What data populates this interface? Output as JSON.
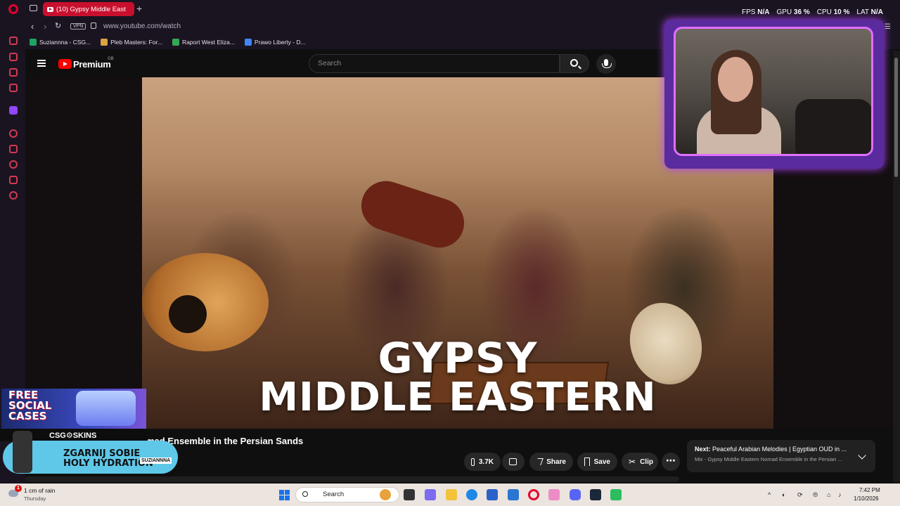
{
  "browser": {
    "tab_title": "(10) Gypsy Middle East",
    "new_tab": "+",
    "vpn_label": "VPN",
    "url": "www.youtube.com/watch",
    "bookmarks": [
      {
        "label": "Suziannna - CSG...",
        "color": "#1fa463"
      },
      {
        "label": "Pleb Masters: For...",
        "color": "#d9a441"
      },
      {
        "label": "Raport West Eliza...",
        "color": "#34a853"
      },
      {
        "label": "Prawo Liberty - D...",
        "color": "#4285f4"
      }
    ]
  },
  "youtube": {
    "brand": "Premium",
    "region": "GB",
    "search_placeholder": "Search",
    "thumbnail_line1": "GYPSY",
    "thumbnail_line2": "MIDDLE EASTERN",
    "title_visible": "mad Ensemble in the Persian Sands",
    "like_count": "3.7K",
    "share_label": "Share",
    "save_label": "Save",
    "clip_label": "Clip",
    "more_label": "⋯",
    "next_prefix": "Next:",
    "next_title": "Peaceful Arabian Melodies | Egyptian OUD in ...",
    "next_sub": "Mix - Gypsy Middle Eastern Nomad Ensemble in the Persian ..."
  },
  "stats": {
    "fps_label": "FPS",
    "fps_value": "N/A",
    "gpu_label": "GPU",
    "gpu_value": "36 %",
    "cpu_label": "CPU",
    "cpu_value": "10 %",
    "lat_label": "LAT",
    "lat_value": "N/A"
  },
  "ad": {
    "free_line1": "FREE",
    "free_line2": "SOCIAL",
    "free_line3": "CASES",
    "brand": "CSG⚙SKINS",
    "promo_line1": "ZGARNIJ SOBIE",
    "promo_line2": "HOLY HYDRATION",
    "badge": "SUZIANNNA"
  },
  "taskbar": {
    "weather_badge": "1",
    "weather_line1": "1 cm of rain",
    "weather_line2": "Thursday",
    "search_label": "Search",
    "time": "7:42 PM",
    "date": "1/10/2026"
  },
  "colors": {
    "accent_red": "#ff0000",
    "opera_red": "#c8102e",
    "webcam_glow": "#b040ff"
  }
}
